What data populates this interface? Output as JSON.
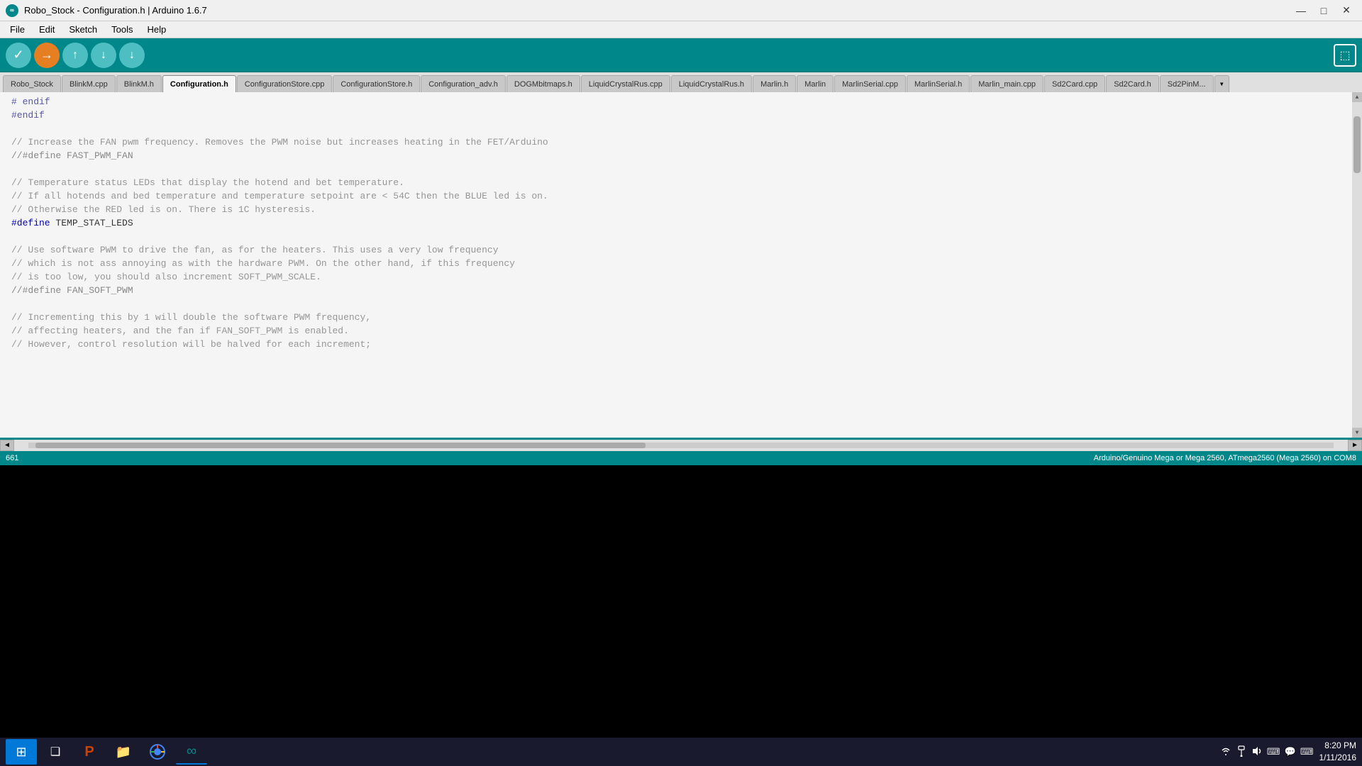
{
  "titlebar": {
    "title": "Robo_Stock - Configuration.h | Arduino 1.6.7",
    "logo_text": "∞"
  },
  "menubar": {
    "items": [
      "File",
      "Edit",
      "Sketch",
      "Tools",
      "Help"
    ]
  },
  "toolbar": {
    "verify_label": "✓",
    "upload_label": "→",
    "new_label": "↑",
    "open_label": "↓",
    "save_label": "↓",
    "serial_label": "⬚"
  },
  "tabs": [
    {
      "id": "tab-robo-stock",
      "label": "Robo_Stock",
      "active": false
    },
    {
      "id": "tab-blinkm-cpp",
      "label": "BlinkM.cpp",
      "active": false
    },
    {
      "id": "tab-blinkm-h",
      "label": "BlinkM.h",
      "active": false
    },
    {
      "id": "tab-configuration-h",
      "label": "Configuration.h",
      "active": true
    },
    {
      "id": "tab-configstore-cpp",
      "label": "ConfigurationStore.cpp",
      "active": false
    },
    {
      "id": "tab-configstore-h",
      "label": "ConfigurationStore.h",
      "active": false
    },
    {
      "id": "tab-config-adv",
      "label": "Configuration_adv.h",
      "active": false
    },
    {
      "id": "tab-dogmbitmaps",
      "label": "DOGMbitmaps.h",
      "active": false
    },
    {
      "id": "tab-liquidcrystal-cpp",
      "label": "LiquidCrystalRus.cpp",
      "active": false
    },
    {
      "id": "tab-liquidcrystal-h",
      "label": "LiquidCrystalRus.h",
      "active": false
    },
    {
      "id": "tab-marlin-h",
      "label": "Marlin.h",
      "active": false
    },
    {
      "id": "tab-marlin",
      "label": "Marlin",
      "active": false
    },
    {
      "id": "tab-marlinserial-cpp",
      "label": "MarlinSerial.cpp",
      "active": false
    },
    {
      "id": "tab-marlinserial-h",
      "label": "MarlinSerial.h",
      "active": false
    },
    {
      "id": "tab-marlin-main",
      "label": "Marlin_main.cpp",
      "active": false
    },
    {
      "id": "tab-sd2card-cpp",
      "label": "Sd2Card.cpp",
      "active": false
    },
    {
      "id": "tab-sd2card-h",
      "label": "Sd2Card.h",
      "active": false
    },
    {
      "id": "tab-sd2pinm",
      "label": "Sd2PinM...",
      "active": false
    }
  ],
  "code_lines": [
    {
      "content": "# endif",
      "class": "c-keyword"
    },
    {
      "content": "#endif",
      "class": "c-keyword"
    },
    {
      "content": "",
      "class": "c-normal"
    },
    {
      "content": "// Increase the FAN pwm frequency. Removes the PWM noise but increases heating in the FET/Arduino",
      "class": "c-comment"
    },
    {
      "content": "//#define FAST_PWM_FAN",
      "class": "c-disabled"
    },
    {
      "content": "",
      "class": "c-normal"
    },
    {
      "content": "// Temperature status LEDs that display the hotend and bet temperature.",
      "class": "c-comment"
    },
    {
      "content": "// If all hotends and bed temperature and temperature setpoint are < 54C then the BLUE led is on.",
      "class": "c-comment"
    },
    {
      "content": "// Otherwise the RED led is on. There is 1C hysteresis.",
      "class": "c-comment"
    },
    {
      "content": "#define TEMP_STAT_LEDS",
      "class": "c-define"
    },
    {
      "content": "",
      "class": "c-normal"
    },
    {
      "content": "// Use software PWM to drive the fan, as for the heaters. This uses a very low frequency",
      "class": "c-comment"
    },
    {
      "content": "// which is not ass annoying as with the hardware PWM. On the other hand, if this frequency",
      "class": "c-comment"
    },
    {
      "content": "// is too low, you should also increment SOFT_PWM_SCALE.",
      "class": "c-comment"
    },
    {
      "content": "//#define FAN_SOFT_PWM",
      "class": "c-disabled"
    },
    {
      "content": "",
      "class": "c-normal"
    },
    {
      "content": "// Incrementing this by 1 will double the software PWM frequency,",
      "class": "c-comment"
    },
    {
      "content": "// affecting heaters, and the fan if FAN_SOFT_PWM is enabled.",
      "class": "c-comment"
    },
    {
      "content": "// However, control resolution will be halved for each increment;",
      "class": "c-comment"
    }
  ],
  "status_bar": {
    "line_number": "661",
    "board_info": "Arduino/Genuino Mega or Mega 2560, ATmega2560 (Mega 2560) on COM8"
  },
  "taskbar": {
    "start_icon": "⊞",
    "apps": [
      {
        "id": "task-windows",
        "icon": "⊞",
        "label": "Start"
      },
      {
        "id": "task-multitask",
        "icon": "❑",
        "label": "Task View"
      },
      {
        "id": "task-powerpoint",
        "icon": "P",
        "label": "PowerPoint"
      },
      {
        "id": "task-explorer",
        "icon": "📁",
        "label": "File Explorer"
      },
      {
        "id": "task-chrome",
        "icon": "◉",
        "label": "Chrome"
      },
      {
        "id": "task-arduino",
        "icon": "∞",
        "label": "Arduino"
      }
    ],
    "systray": {
      "network_icon": "🌐",
      "volume_icon": "🔊",
      "keyboard_icon": "⌨",
      "chat_icon": "💬",
      "keyboard2_icon": "⌨",
      "time": "8:20 PM",
      "date": "1/11/2016"
    }
  }
}
